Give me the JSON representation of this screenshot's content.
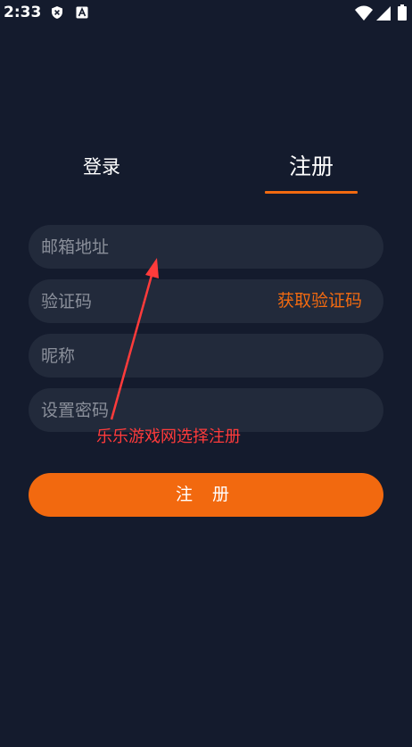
{
  "status_bar": {
    "time": "2:33",
    "icons": [
      "shield-icon",
      "a-icon",
      "wifi-icon",
      "signal-icon",
      "battery-icon"
    ]
  },
  "tabs": {
    "login_label": "登录",
    "register_label": "注册",
    "active": "register"
  },
  "form": {
    "email_placeholder": "邮箱地址",
    "code_placeholder": "验证码",
    "get_code_label": "获取验证码",
    "nickname_placeholder": "昵称",
    "password_placeholder": "设置密码"
  },
  "submit_label": "注 册",
  "annotation": {
    "text": "乐乐游戏网选择注册"
  },
  "colors": {
    "background": "#141b2d",
    "field_background": "#222a3b",
    "accent": "#f26a10",
    "annotation": "#ff3b3b"
  }
}
